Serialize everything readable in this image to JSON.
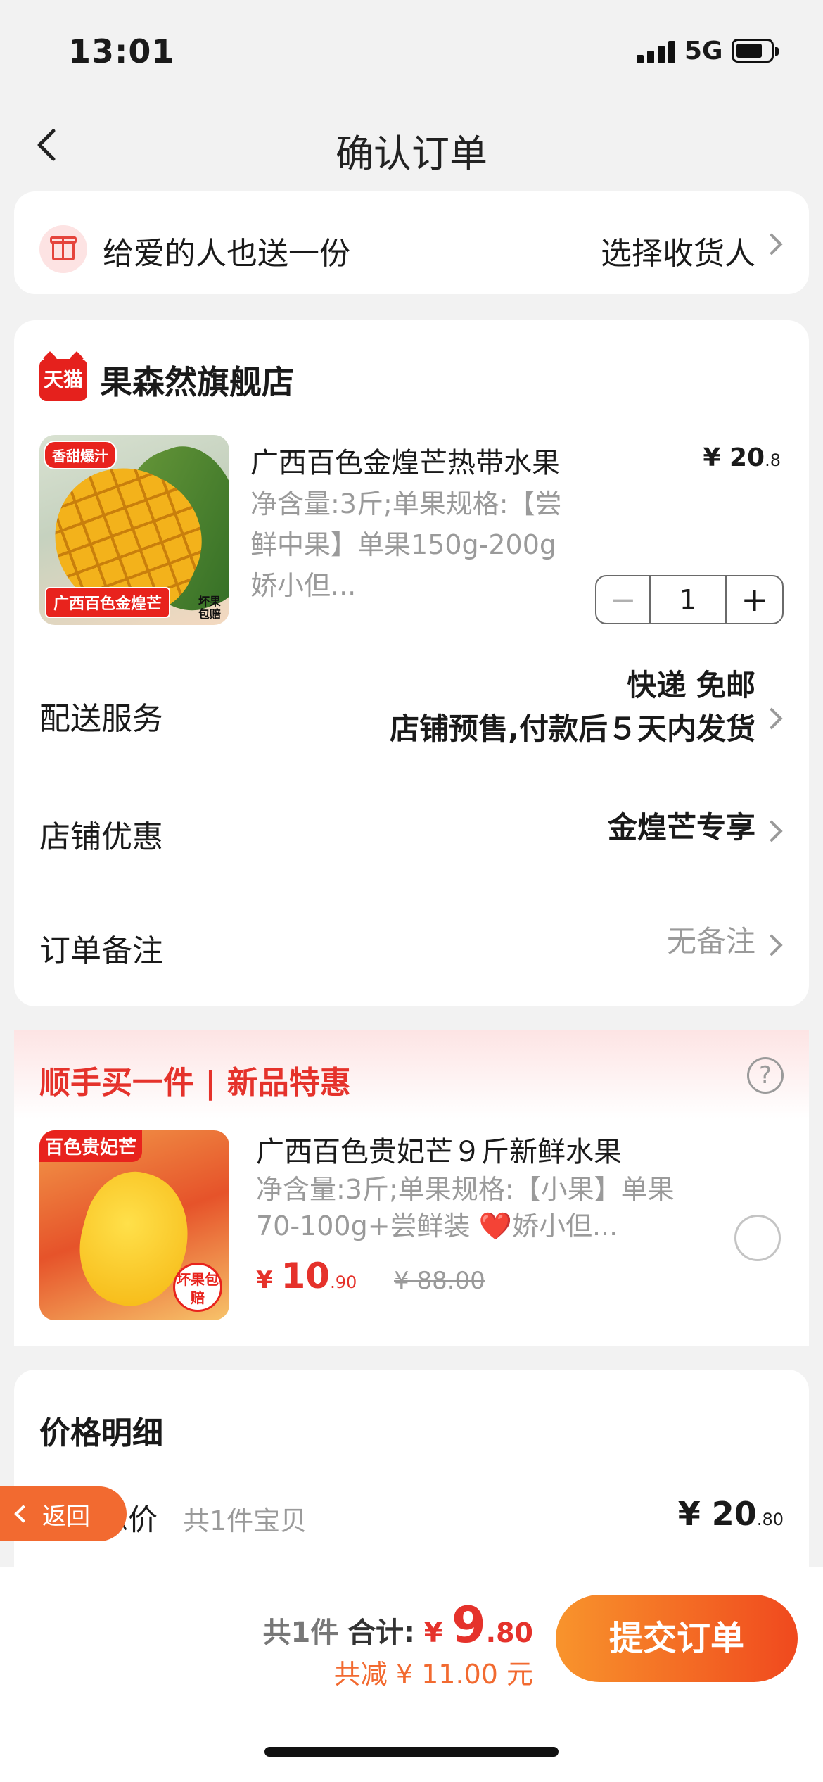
{
  "status_bar": {
    "time": "13:01",
    "network": "5G"
  },
  "nav": {
    "title": "确认订单"
  },
  "gift": {
    "text": "给爱的人也送一份",
    "action": "选择收货人"
  },
  "store": {
    "badge": "天猫",
    "name": "果森然旗舰店",
    "product": {
      "title": "广西百色金煌芒热带水果",
      "price_int": "¥ 20",
      "price_dec": ".8",
      "spec": "净含量:3斤;单果规格:【尝鲜中果】单果150g-200g 娇小但...",
      "img_badge_top": "香甜爆汁",
      "img_badge_bottom": "广西百色金煌芒",
      "img_badge_side": "坏果包赔",
      "quantity": "1",
      "minus": "−",
      "plus": "+"
    },
    "delivery": {
      "label": "配送服务",
      "line1": "快递 免邮",
      "line2": "店铺预售,付款后５天内发货"
    },
    "discount": {
      "label": "店铺优惠",
      "value": "金煌芒专享"
    },
    "note": {
      "label": "订单备注",
      "value": "无备注"
    }
  },
  "upsell": {
    "title": "顺手买一件 | 新品特惠",
    "help": "?",
    "product": {
      "title": "广西百色贵妃芒９斤新鲜水果",
      "spec": "净含量:3斤;单果规格:【小果】单果 70-100g+尝鲜装 ❤️娇小但...",
      "price_cur": "¥ ",
      "price_int": "10",
      "price_dec": ".90",
      "old_price": "¥ 88.00",
      "img_tag": "百色贵妃芒",
      "img_round": "坏果包赔"
    }
  },
  "price_detail": {
    "title": "价格明细",
    "row_label": "商品总价",
    "row_sub": "共1件宝贝",
    "row_int": "¥ 20",
    "row_dec": ".80"
  },
  "float_back": {
    "label": "返回"
  },
  "footer": {
    "count": "共1件",
    "total_label": "合计:",
    "currency": "¥",
    "total_int": "9",
    "total_dec": ".80",
    "saving": "共减 ¥ 11.00 元",
    "submit": "提交订单"
  },
  "colors": {
    "accent": "#e5322b",
    "orange": "#f26a30",
    "background": "#f2f2f2"
  }
}
